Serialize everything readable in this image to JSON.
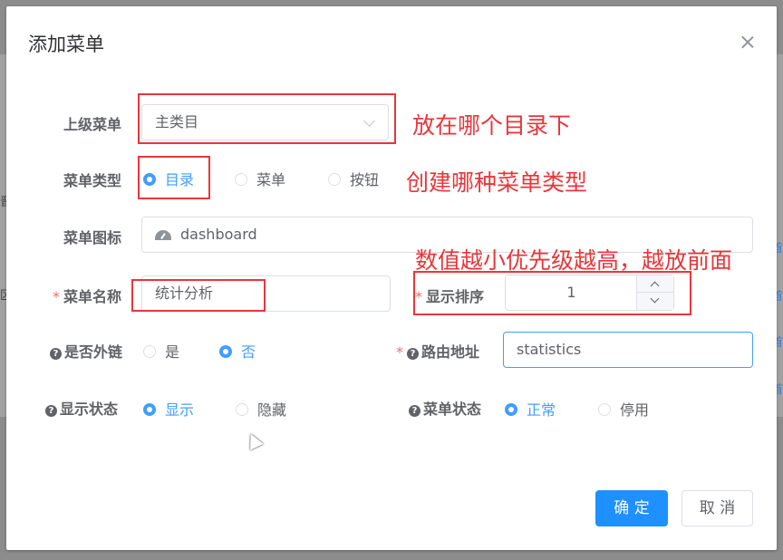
{
  "background": {
    "edge_glyphs": [
      "晋",
      "区",
      "首",
      "首",
      "首",
      "首"
    ]
  },
  "dialog": {
    "title": "添加菜单"
  },
  "form": {
    "parent_menu": {
      "label": "上级菜单",
      "value": "主类目"
    },
    "menu_type": {
      "label": "菜单类型",
      "options": [
        "目录",
        "菜单",
        "按钮"
      ],
      "selected": "目录"
    },
    "menu_icon": {
      "label": "菜单图标",
      "icon": "dashboard-icon",
      "value": "dashboard"
    },
    "menu_name": {
      "label": "菜单名称",
      "required_mark": "*",
      "value": "统计分析"
    },
    "display_order": {
      "label": "显示排序",
      "required_mark": "*",
      "value": "1"
    },
    "external_link": {
      "label": "是否外链",
      "help": "?",
      "options": [
        "是",
        "否"
      ],
      "selected": "否"
    },
    "route_path": {
      "label": "路由地址",
      "required_mark": "*",
      "help": "?",
      "value": "statistics"
    },
    "display_status": {
      "label": "显示状态",
      "help": "?",
      "options": [
        "显示",
        "隐藏"
      ],
      "selected": "显示"
    },
    "menu_status": {
      "label": "菜单状态",
      "help": "?",
      "options": [
        "正常",
        "停用"
      ],
      "selected": "正常"
    }
  },
  "annotations": {
    "parent_note": "放在哪个目录下",
    "type_note": "创建哪种菜单类型",
    "order_note": "数值越小优先级越高，越放前面"
  },
  "footer": {
    "confirm_label": "确 定",
    "cancel_label": "取 消"
  },
  "colors": {
    "primary": "#1e90ff",
    "annotation": "#e8363b",
    "required": "#f56c6c"
  }
}
